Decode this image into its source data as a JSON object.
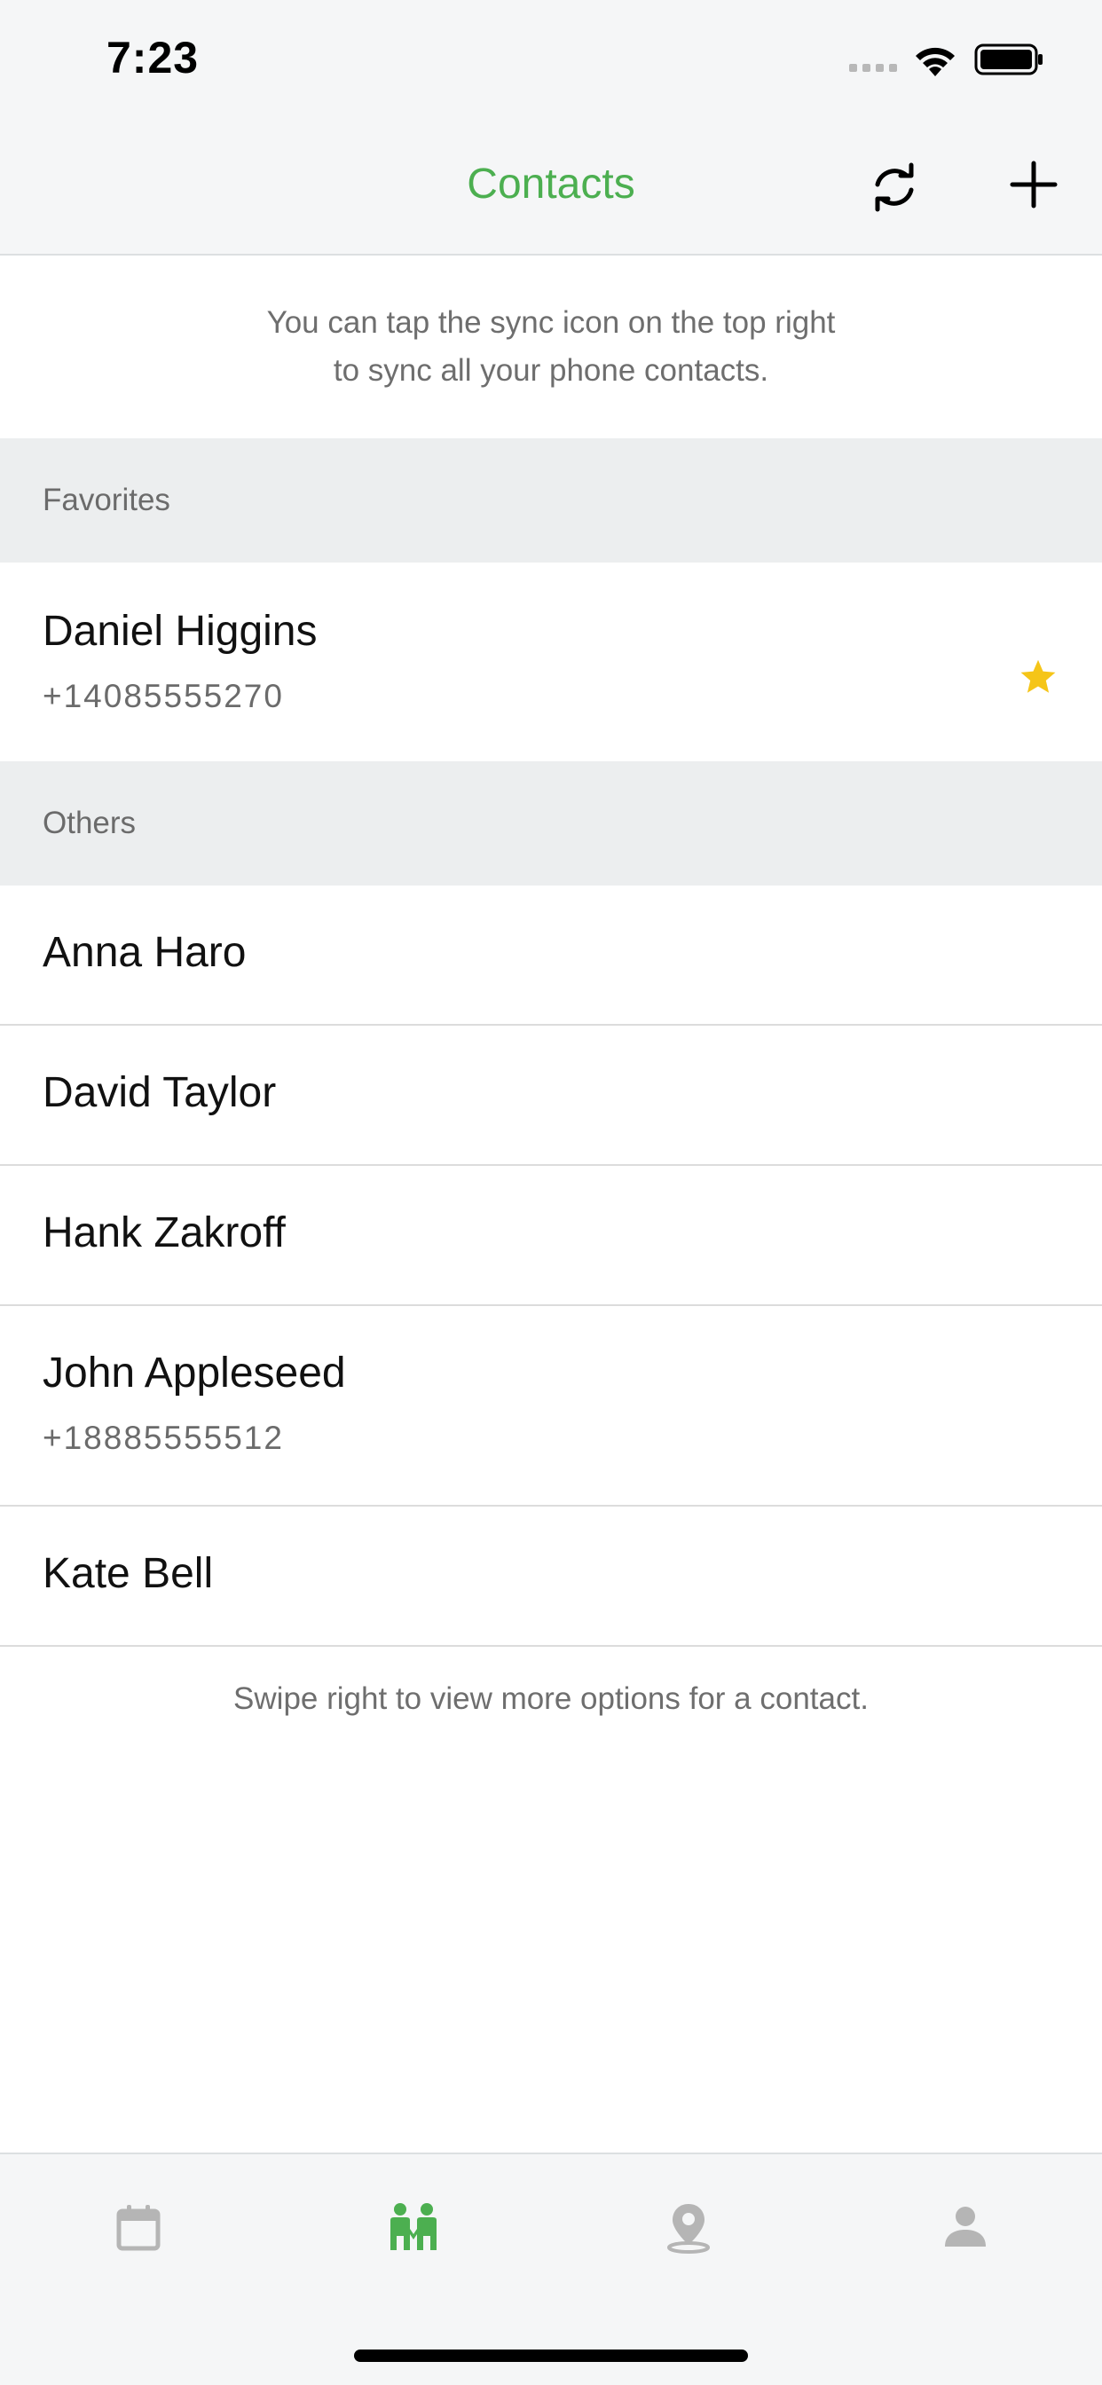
{
  "status_bar": {
    "time": "7:23"
  },
  "nav": {
    "title": "Contacts"
  },
  "hints": {
    "top_line1": "You can tap the sync icon on the top right",
    "top_line2": "to sync all your phone contacts.",
    "bottom": "Swipe right to view more options for a contact."
  },
  "sections": {
    "favorites": "Favorites",
    "others": "Others"
  },
  "favorites": [
    {
      "name": "Daniel Higgins",
      "phone": "+14085555270",
      "starred": true
    }
  ],
  "others": [
    {
      "name": "Anna Haro",
      "phone": ""
    },
    {
      "name": "David Taylor",
      "phone": ""
    },
    {
      "name": "Hank Zakroff",
      "phone": ""
    },
    {
      "name": "John Appleseed",
      "phone": "+18885555512"
    },
    {
      "name": "Kate Bell",
      "phone": ""
    }
  ],
  "tabs": [
    {
      "icon": "calendar-icon",
      "active": false
    },
    {
      "icon": "contacts-icon",
      "active": true
    },
    {
      "icon": "location-pin-icon",
      "active": false
    },
    {
      "icon": "profile-icon",
      "active": false
    }
  ],
  "colors": {
    "accent": "#4caf50",
    "star": "#f5c518",
    "inactive_tab": "#b5b5b5"
  }
}
